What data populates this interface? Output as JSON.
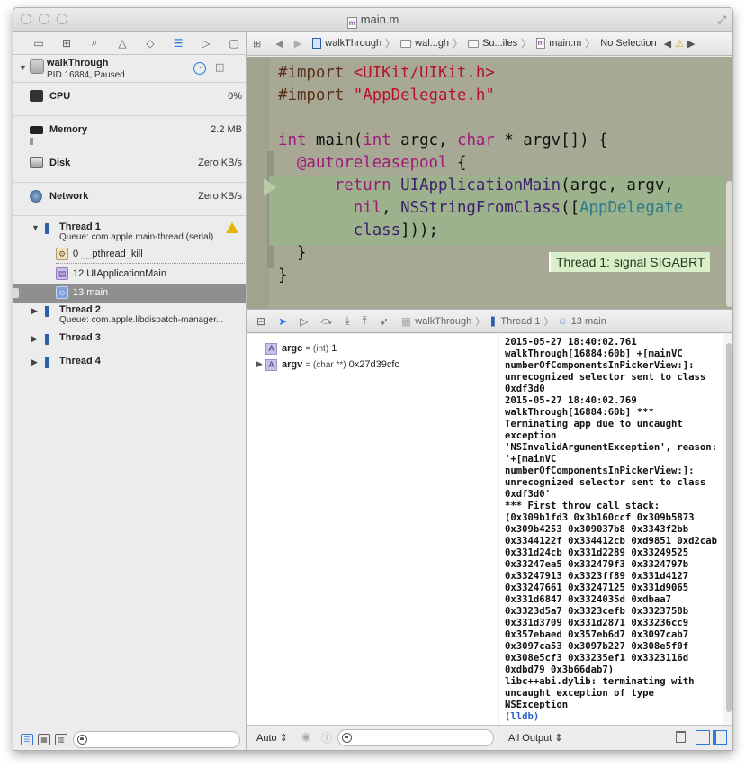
{
  "window": {
    "title": "main.m"
  },
  "navigator": {
    "process": {
      "name": "walkThrough",
      "subtitle": "PID 16884, Paused"
    },
    "gauges": [
      {
        "label": "CPU",
        "value": "0%"
      },
      {
        "label": "Memory",
        "value": "2.2 MB"
      },
      {
        "label": "Disk",
        "value": "Zero KB/s"
      },
      {
        "label": "Network",
        "value": "Zero KB/s"
      }
    ],
    "threads": [
      {
        "name": "Thread 1",
        "queue": "Queue: com.apple.main-thread (serial)",
        "expanded": true
      },
      {
        "name": "Thread 2",
        "queue": "Queue: com.apple.libdispatch-manager..."
      },
      {
        "name": "Thread 3"
      },
      {
        "name": "Thread 4"
      }
    ],
    "frames": [
      {
        "label": "0 __pthread_kill"
      },
      {
        "label": "12 UIApplicationMain"
      },
      {
        "label": "13 main",
        "selected": true
      }
    ]
  },
  "jumpbar": {
    "project": "walkThrough",
    "group1": "wal...gh",
    "group2": "Su...iles",
    "file": "main.m",
    "selection": "No Selection"
  },
  "editor": {
    "lines": {
      "l1a": "#import ",
      "l1b": "<UIKit/UIKit.h>",
      "l2a": "#import ",
      "l2b": "\"AppDelegate.h\"",
      "l4a": "int",
      "l4b": " main(",
      "l4c": "int",
      "l4d": " argc, ",
      "l4e": "char",
      "l4f": " * argv[]) {",
      "l5a": "  @autoreleasepool",
      "l5b": " {",
      "l6a": "      return ",
      "l6b": "UIApplicationMain",
      "l6c": "(argc, argv,",
      "l7a": "        nil",
      "l7b": ", ",
      "l7c": "NSStringFromClass",
      "l7d": "([",
      "l7e": "AppDelegate",
      "l8a": "        class",
      "l8b": "]));",
      "l9": "  }",
      "l10": "}"
    },
    "signal_badge": "Thread 1: signal SIGABRT"
  },
  "debugbar": {
    "project": "walkThrough",
    "thread": "Thread 1",
    "frame": "13 main"
  },
  "variables": [
    {
      "name": "argc",
      "type": "= (int)",
      "value": "1"
    },
    {
      "name": "argv",
      "type": "= (char **)",
      "value": "0x27d39cfc"
    }
  ],
  "variables_footer": {
    "scope": "Auto ⇕"
  },
  "console": {
    "text": "2015-05-27 18:40:02.761 walkThrough[16884:60b] +[mainVC numberOfComponentsInPickerView:]: unrecognized selector sent to class 0xdf3d0\n2015-05-27 18:40:02.769 walkThrough[16884:60b] *** Terminating app due to uncaught exception 'NSInvalidArgumentException', reason: '+[mainVC numberOfComponentsInPickerView:]: unrecognized selector sent to class 0xdf3d0'\n*** First throw call stack:\n(0x309b1fd3 0x3b160ccf 0x309b5873 0x309b4253 0x309037b8 0x3343f2bb 0x3344122f 0x334412cb 0xd9851 0xd2cab 0x331d24cb 0x331d2289 0x33249525 0x33247ea5 0x332479f3 0x3324797b 0x33247913 0x3323ff89 0x331d4127 0x33247661 0x33247125 0x331d9065 0x331d6847 0x3324035d 0xdbaa7 0x3323d5a7 0x3323cefb 0x3323758b 0x331d3709 0x331d2871 0x33236cc9 0x357ebaed 0x357eb6d7 0x3097cab7 0x3097ca53 0x3097b227 0x308e5f0f 0x308e5cf3 0x33235ef1 0x3323116d 0xdbd79 0x3b66dab7)\nlibc++abi.dylib: terminating with uncaught exception of type NSException",
    "prompt": "(lldb)",
    "output_selector": "All Output ⇕"
  }
}
